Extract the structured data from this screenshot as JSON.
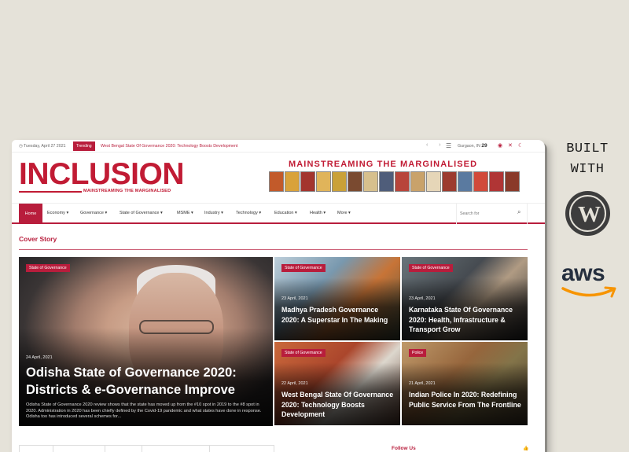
{
  "topbar": {
    "date": "Tuesday, April 27 2021",
    "trending_label": "Trending",
    "trending_text": "West Bengal State Of Governance 2020: Technology Boosts Development",
    "location": "Gurgaon, IN",
    "temperature": "29"
  },
  "header": {
    "logo_text": "INCLUSION",
    "logo_tagline": "MAINSTREAMING THE MARGINALISED",
    "banner_title": "MAINSTREAMING THE MARGINALISED"
  },
  "nav": {
    "home": "Home",
    "items": [
      "Economy",
      "Governance",
      "State of Governance",
      "MSME",
      "Industry",
      "Technology",
      "Education",
      "Health",
      "More"
    ],
    "search_placeholder": "Search for"
  },
  "section": {
    "title": "Cover Story"
  },
  "cards": [
    {
      "badge": "State of Governance",
      "date": "24 April, 2021",
      "title": "Odisha State of Governance 2020: Districts & e-Governance Improve",
      "excerpt": "Odisha State of Governance 2020 review shows that the state has moved up from the #10 spot in 2019 to the #8 spot in 2020. Administration in 2020 has been chiefly defined by the Covid-19 pandemic and what states have done in response. Odisha too has introduced several schemes for..."
    },
    {
      "badge": "State of Governance",
      "date": "23 April, 2021",
      "title": "Madhya Pradesh Governance 2020: A Superstar In The Making"
    },
    {
      "badge": "State of Governance",
      "date": "23 April, 2021",
      "title": "Karnataka State Of Governance 2020: Health, Infrastructure & Transport Grow"
    },
    {
      "badge": "State of Governance",
      "date": "22 April, 2021",
      "title": "West Bengal State Of Governance 2020: Technology Boosts Development"
    },
    {
      "badge": "Police",
      "date": "21 April, 2021",
      "title": "Indian Police In 2020: Redefining Public Service From The Frontline"
    }
  ],
  "sidebar": {
    "follow_us": "Follow Us"
  },
  "promo": {
    "built_line1": "BUILT",
    "built_line2": "WITH",
    "wordpress_letter": "W",
    "aws_text": "aws"
  },
  "colors": {
    "brand": "#b81d3c",
    "background": "#e5e2d9"
  }
}
